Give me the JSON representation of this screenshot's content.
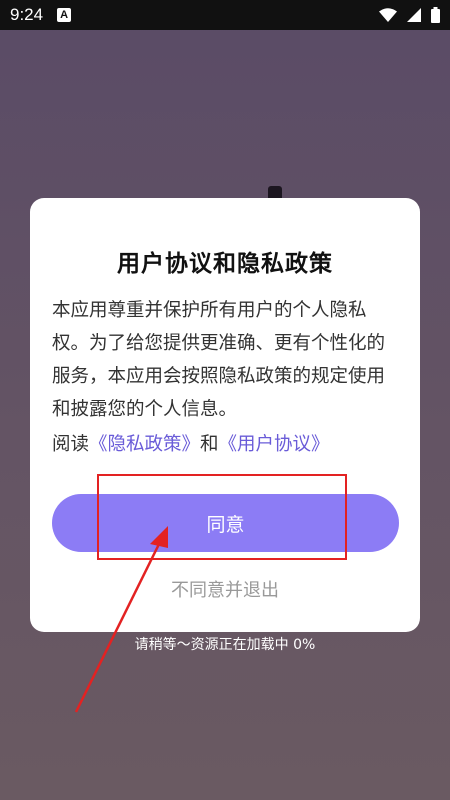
{
  "status_bar": {
    "time": "9:24",
    "notification_badge": "A",
    "icons": [
      "notification-a-icon",
      "wifi-icon",
      "signal-icon",
      "battery-icon"
    ]
  },
  "dialog": {
    "title": "用户协议和隐私政策",
    "body": "本应用尊重并保护所有用户的个人隐私权。为了给您提供更准确、更有个性化的服务，本应用会按照隐私政策的规定使用和披露您的个人信息。",
    "links_prefix": "阅读",
    "privacy_link": "《隐私政策》",
    "links_joiner": "和",
    "agreement_link": "《用户协议》",
    "agree_label": "同意",
    "disagree_label": "不同意并退出"
  },
  "loading_text": "请稍等～资源正在加载中 0%",
  "colors": {
    "accent": "#8c7cf5",
    "link": "#6a5cd8",
    "annotation": "#e32222",
    "status_bar": "#111111"
  }
}
